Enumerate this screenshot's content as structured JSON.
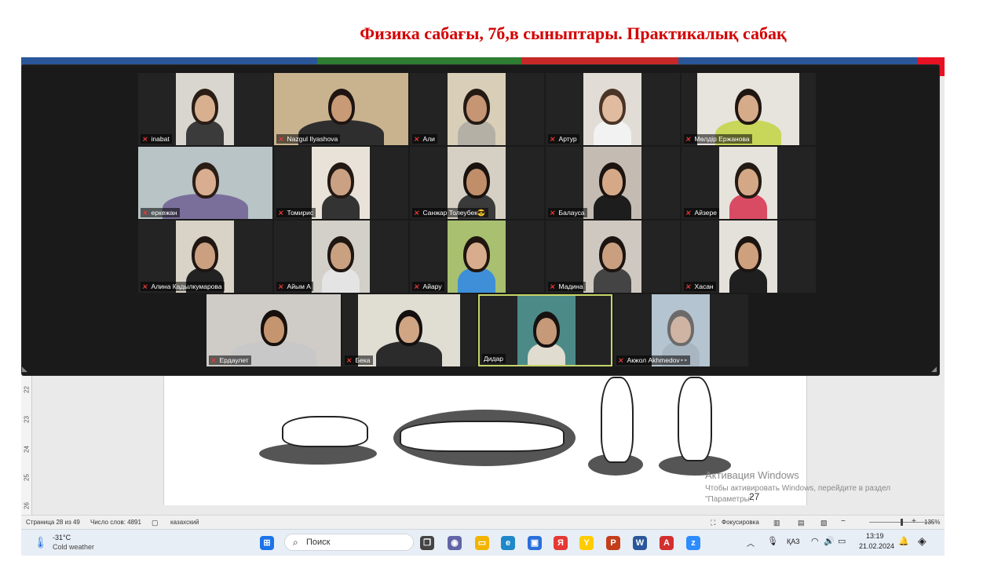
{
  "slide": {
    "title": "Физика сабағы, 7б,в сыныптары. Практикалық сабақ"
  },
  "zoom": {
    "participants": [
      {
        "name": "inabat",
        "row": 0,
        "col": 0,
        "bg": "#d9d6cf",
        "skin": "#d8b08f",
        "hair": "#2a1d16",
        "shirt": "#3b3b3b",
        "vidLeft": 48,
        "vidWidth": 74
      },
      {
        "name": "Nazgul Ilyashova",
        "row": 0,
        "col": 1,
        "bg": "#c9b38e",
        "skin": "#c89a75",
        "hair": "#1e1512",
        "shirt": "#2e2e2e",
        "vidLeft": 0,
        "vidWidth": 171
      },
      {
        "name": "Али",
        "row": 0,
        "col": 2,
        "bg": "#d9cfb8",
        "skin": "#c59574",
        "hair": "#241a14",
        "shirt": "#b4b0a6",
        "vidLeft": 48,
        "vidWidth": 74
      },
      {
        "name": "Артур",
        "row": 0,
        "col": 3,
        "bg": "#e1dcd5",
        "skin": "#e1bba0",
        "hair": "#4a3426",
        "shirt": "#f2f2f2",
        "vidLeft": 48,
        "vidWidth": 74
      },
      {
        "name": "Мөлдір Ержанова",
        "row": 0,
        "col": 4,
        "bg": "#e7e3dd",
        "skin": "#d6ab8a",
        "hair": "#1f1612",
        "shirt": "#c8d65a",
        "vidLeft": 20,
        "vidWidth": 130
      },
      {
        "name": "еркежан",
        "row": 1,
        "col": 0,
        "bg": "#b8c4c6",
        "skin": "#d9ae90",
        "hair": "#2a1d16",
        "shirt": "#7a6f9a",
        "vidLeft": 0,
        "vidWidth": 171
      },
      {
        "name": "Томирис",
        "row": 1,
        "col": 1,
        "bg": "#e8e2d8",
        "skin": "#caa183",
        "hair": "#231814",
        "shirt": "#333333",
        "vidLeft": 48,
        "vidWidth": 74
      },
      {
        "name": "Санжар Толеубек😎",
        "row": 1,
        "col": 2,
        "bg": "#d6d0c4",
        "skin": "#c18e6a",
        "hair": "#19120e",
        "shirt": "#3a3a3a",
        "vidLeft": 48,
        "vidWidth": 74
      },
      {
        "name": "Балауса",
        "row": 1,
        "col": 3,
        "bg": "#c4bcb2",
        "skin": "#d5a988",
        "hair": "#1b1411",
        "shirt": "#1d1d1d",
        "vidLeft": 48,
        "vidWidth": 74
      },
      {
        "name": "Айзере",
        "row": 1,
        "col": 4,
        "bg": "#e6e2dc",
        "skin": "#d4a886",
        "hair": "#241a14",
        "shirt": "#d94b62",
        "vidLeft": 48,
        "vidWidth": 74
      },
      {
        "name": "Алина Кадылкумарова",
        "row": 2,
        "col": 0,
        "bg": "#d8d2c7",
        "skin": "#caa081",
        "hair": "#1f1612",
        "shirt": "#222222",
        "vidLeft": 48,
        "vidWidth": 74
      },
      {
        "name": "Айым А",
        "row": 2,
        "col": 1,
        "bg": "#d3cfc9",
        "skin": "#c9a080",
        "hair": "#1f1612",
        "shirt": "#e4e4e4",
        "vidLeft": 48,
        "vidWidth": 74
      },
      {
        "name": "Айару",
        "row": 2,
        "col": 2,
        "bg": "#a8c070",
        "skin": "#d7ad8d",
        "hair": "#20160f",
        "shirt": "#3f8fd8",
        "vidLeft": 48,
        "vidWidth": 74
      },
      {
        "name": "Мадина",
        "row": 2,
        "col": 3,
        "bg": "#cfc8c0",
        "skin": "#c99f80",
        "hair": "#1c1410",
        "shirt": "#444444",
        "vidLeft": 48,
        "vidWidth": 74
      },
      {
        "name": "Хасан",
        "row": 2,
        "col": 4,
        "bg": "#e4e0da",
        "skin": "#cfa07d",
        "hair": "#1c1410",
        "shirt": "#1f1f1f",
        "vidLeft": 48,
        "vidWidth": 74
      },
      {
        "name": "Ердаулет",
        "row": 3,
        "col": 0,
        "bg": "#cfcbc6",
        "skin": "#c4956f",
        "hair": "#17110d",
        "shirt": "#c8c8c8",
        "vidLeft": 0,
        "vidWidth": 171
      },
      {
        "name": "Бека",
        "row": 3,
        "col": 1,
        "bg": "#e0ddd2",
        "skin": "#d0a584",
        "hair": "#141010",
        "shirt": "#2b2b2b",
        "vidLeft": 20,
        "vidWidth": 130
      },
      {
        "name": "Дидар",
        "row": 3,
        "col": 2,
        "bg": "#4c8a88",
        "skin": "#c69a78",
        "hair": "#171210",
        "shirt": "#e0dccf",
        "vidLeft": 48,
        "vidWidth": 74,
        "active": true
      },
      {
        "name": "Акжол Akhmedov👓",
        "row": 3,
        "col": 3,
        "bg": "#b4c4d0",
        "skin": "#cfb4a4",
        "hair": "#6d6a6a",
        "shirt": "#a8b6c2",
        "vidLeft": 48,
        "vidWidth": 74
      }
    ]
  },
  "word": {
    "ruler_numbers": [
      "22",
      "23",
      "24",
      "25",
      "26"
    ],
    "page_number": "27",
    "activation_title": "Активация Windows",
    "activation_text1": "Чтобы активировать Windows, перейдите в раздел",
    "activation_text2": "\"Параметры\".",
    "status": {
      "page": "Страница 28 из 49",
      "words": "Число слов: 4891",
      "language": "казахский",
      "focus": "Фокусировка",
      "zoom": "135%"
    }
  },
  "taskbar": {
    "weather_temp": "-31°C",
    "weather_desc": "Cold weather",
    "search_placeholder": "Поиск",
    "keyboard_lang": "ҚАЗ",
    "time": "13:19",
    "date": "21.02.2024",
    "apps": [
      {
        "name": "start",
        "color": "#1a73e8",
        "glyph": "⊞"
      },
      {
        "name": "taskview",
        "color": "#444444",
        "glyph": "❐"
      },
      {
        "name": "chat",
        "color": "#6264a7",
        "glyph": "◉"
      },
      {
        "name": "explorer",
        "color": "#f2b400",
        "glyph": "▭"
      },
      {
        "name": "edge",
        "color": "#1e88c8",
        "glyph": "e"
      },
      {
        "name": "store",
        "color": "#2a6fdb",
        "glyph": "▣"
      },
      {
        "name": "yandex",
        "color": "#e53935",
        "glyph": "Я"
      },
      {
        "name": "yandex-browser",
        "color": "#ffcc00",
        "glyph": "Y"
      },
      {
        "name": "powerpoint",
        "color": "#c43e1c",
        "glyph": "P"
      },
      {
        "name": "word",
        "color": "#2b579a",
        "glyph": "W"
      },
      {
        "name": "acrobat",
        "color": "#d32f2f",
        "glyph": "A"
      },
      {
        "name": "zoom",
        "color": "#2d8cff",
        "glyph": "z"
      }
    ]
  }
}
